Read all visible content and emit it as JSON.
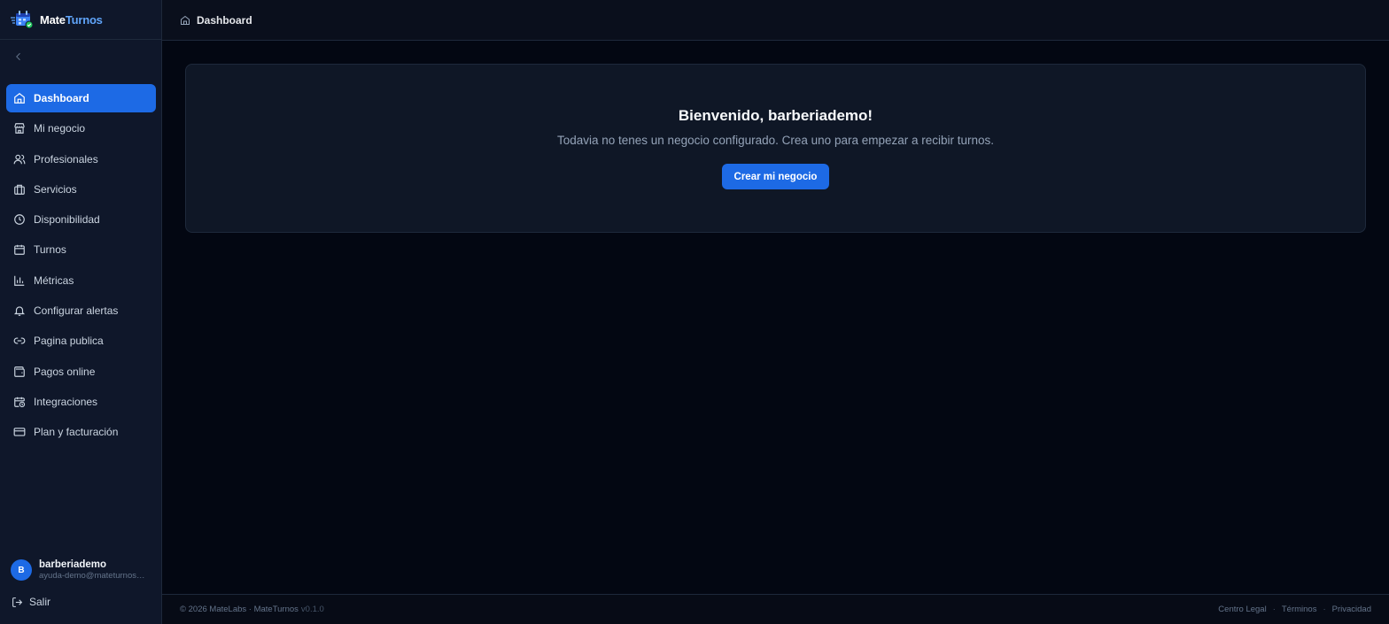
{
  "brand": {
    "name_part1": "Mate",
    "name_part2": "Turnos",
    "logo_icon": "calendar-check-icon"
  },
  "sidebar": {
    "collapse_icon": "chevron-left-icon",
    "items": [
      {
        "label": "Dashboard",
        "icon": "home-icon",
        "active": true
      },
      {
        "label": "Mi negocio",
        "icon": "store-icon"
      },
      {
        "label": "Profesionales",
        "icon": "users-icon"
      },
      {
        "label": "Servicios",
        "icon": "briefcase-icon"
      },
      {
        "label": "Disponibilidad",
        "icon": "clock-icon"
      },
      {
        "label": "Turnos",
        "icon": "calendar-icon"
      },
      {
        "label": "Métricas",
        "icon": "bar-chart-icon"
      },
      {
        "label": "Configurar alertas",
        "icon": "bell-icon"
      },
      {
        "label": "Pagina publica",
        "icon": "link-icon"
      },
      {
        "label": "Pagos online",
        "icon": "wallet-icon"
      },
      {
        "label": "Integraciones",
        "icon": "calendar-clock-icon"
      },
      {
        "label": "Plan y facturación",
        "icon": "credit-card-icon"
      }
    ]
  },
  "user": {
    "initial": "B",
    "name": "barberiademo",
    "email": "ayuda-demo@mateturnos.com"
  },
  "logout": {
    "label": "Salir",
    "icon": "logout-icon"
  },
  "header": {
    "breadcrumb": "Dashboard",
    "icon": "home-icon"
  },
  "main": {
    "welcome": "Bienvenido, barberiademo!",
    "subtitle": "Todavia no tenes un negocio configurado. Crea uno para empezar a recibir turnos.",
    "cta_label": "Crear mi negocio"
  },
  "footer": {
    "copyright": "© 2026 MateLabs · MateTurnos",
    "version": "v0.1.0",
    "links": [
      "Centro Legal",
      "Términos",
      "Privacidad"
    ],
    "separator": "·"
  },
  "colors": {
    "accent": "#1d6ae5",
    "brand_secondary": "#60a5fa",
    "background": "#030712",
    "sidebar": "#0f172a"
  }
}
